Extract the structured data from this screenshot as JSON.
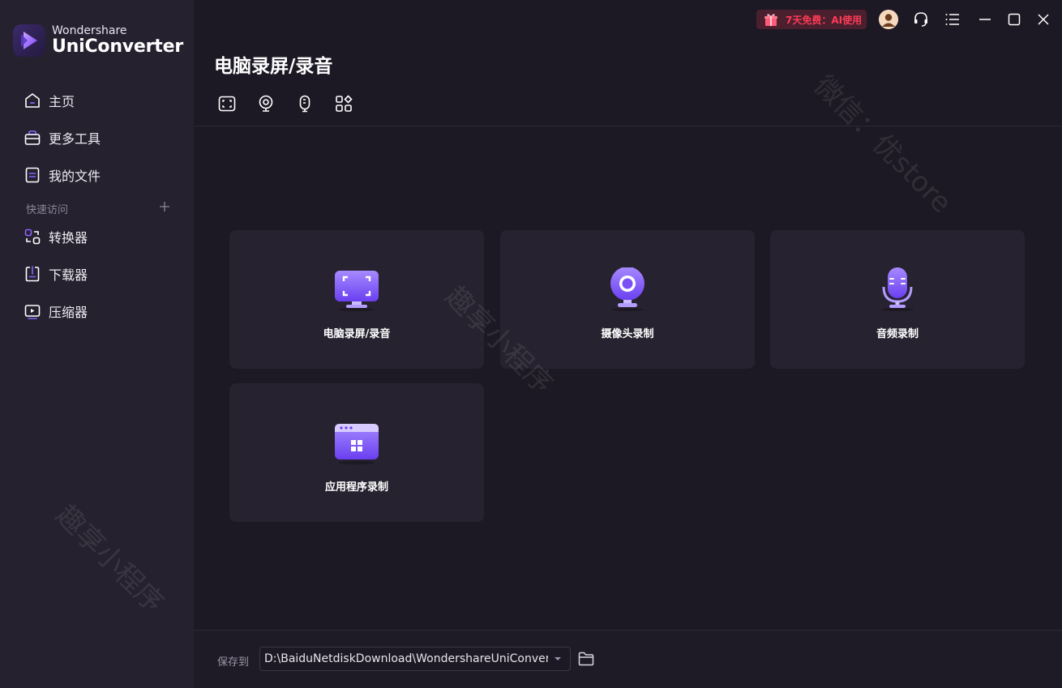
{
  "brand": {
    "top": "Wondershare",
    "main": "UniConverter"
  },
  "sidebar": {
    "main_items": [
      {
        "label": "主页",
        "icon": "home-icon"
      },
      {
        "label": "更多工具",
        "icon": "toolbox-icon"
      },
      {
        "label": "我的文件",
        "icon": "file-icon"
      }
    ],
    "quick_header": "快速访问",
    "quick_items": [
      {
        "label": "转换器",
        "icon": "converter-icon"
      },
      {
        "label": "下载器",
        "icon": "downloader-icon"
      },
      {
        "label": "压缩器",
        "icon": "compressor-icon"
      }
    ]
  },
  "titlebar": {
    "promo_text": "7天免费：AI使用",
    "icons": [
      "gift-icon",
      "avatar",
      "headset-icon",
      "menu-icon",
      "minimize-icon",
      "maximize-icon",
      "close-icon"
    ]
  },
  "main": {
    "title": "电脑录屏/录音",
    "mode_tabs": [
      "screen-record-icon",
      "webcam-icon",
      "audio-icon",
      "apps-icon"
    ],
    "cards": [
      {
        "label": "电脑录屏/录音",
        "icon": "screen-recorder-icon"
      },
      {
        "label": "摄像头录制",
        "icon": "webcam-recorder-icon"
      },
      {
        "label": "音频录制",
        "icon": "microphone-icon"
      },
      {
        "label": "应用程序录制",
        "icon": "app-window-icon"
      }
    ]
  },
  "bottom": {
    "save_label": "保存到",
    "path": "D:\\BaiduNetdiskDownload\\WondershareUniConvert"
  },
  "watermarks": [
    "微信：优store",
    "趣享小程序",
    "趣享小程序"
  ],
  "colors": {
    "accent": "#8a63ff",
    "promo_text": "#ff3b57",
    "background": "#1c1924",
    "sidebar": "#25212f",
    "card": "#26222f"
  }
}
